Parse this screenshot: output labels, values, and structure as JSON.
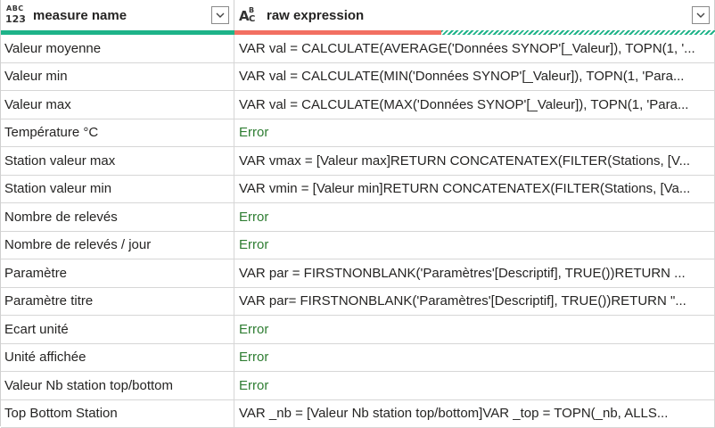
{
  "columns": [
    {
      "label": "measure name",
      "type_icon": "abc-123-type-icon"
    },
    {
      "label": "raw expression",
      "type_icon": "abc-type-icon"
    }
  ],
  "type_icons": {
    "abc": "ABC",
    "num": "123",
    "a": "A",
    "b": "B",
    "c": "C"
  },
  "colors": {
    "valid": "#1eb389",
    "error": "#f27062",
    "error_text": "#2e7d32"
  },
  "rows": [
    {
      "name": "Valeur moyenne",
      "expr": "VAR val = CALCULATE(AVERAGE('Données SYNOP'[_Valeur]), TOPN(1, '...",
      "error": false
    },
    {
      "name": "Valeur min",
      "expr": "VAR val = CALCULATE(MIN('Données SYNOP'[_Valeur]), TOPN(1, 'Para...",
      "error": false
    },
    {
      "name": "Valeur max",
      "expr": "VAR val = CALCULATE(MAX('Données SYNOP'[_Valeur]), TOPN(1, 'Para...",
      "error": false
    },
    {
      "name": "Température °C",
      "expr": "Error",
      "error": true
    },
    {
      "name": "Station valeur max",
      "expr": "VAR vmax = [Valeur max]RETURN CONCATENATEX(FILTER(Stations, [V...",
      "error": false
    },
    {
      "name": "Station valeur min",
      "expr": "VAR vmin = [Valeur min]RETURN CONCATENATEX(FILTER(Stations, [Va...",
      "error": false
    },
    {
      "name": "Nombre de relevés",
      "expr": "Error",
      "error": true
    },
    {
      "name": "Nombre de relevés / jour",
      "expr": "Error",
      "error": true
    },
    {
      "name": "Paramètre",
      "expr": "VAR par = FIRSTNONBLANK('Paramètres'[Descriptif], TRUE())RETURN ...",
      "error": false
    },
    {
      "name": "Paramètre titre",
      "expr": "VAR par= FIRSTNONBLANK('Paramètres'[Descriptif], TRUE())RETURN \"...",
      "error": false
    },
    {
      "name": "Ecart unité",
      "expr": "Error",
      "error": true
    },
    {
      "name": "Unité affichée",
      "expr": "Error",
      "error": true
    },
    {
      "name": "Valeur Nb station top/bottom",
      "expr": "Error",
      "error": true
    },
    {
      "name": "Top Bottom Station",
      "expr": "VAR _nb = [Valeur Nb station top/bottom]VAR _top = TOPN(_nb, ALLS...",
      "error": false
    }
  ]
}
